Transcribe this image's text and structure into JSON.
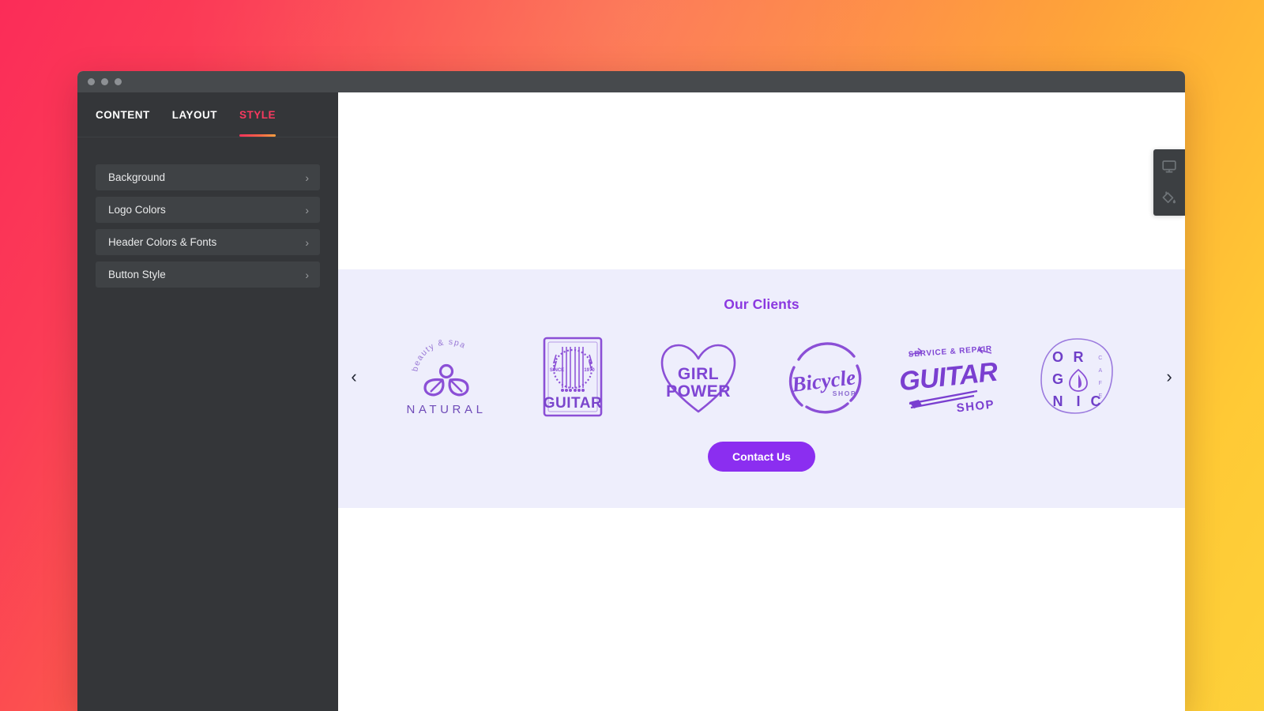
{
  "window": {
    "traffic_lights": [
      "close",
      "minimize",
      "maximize"
    ]
  },
  "sidebar": {
    "tabs": [
      {
        "label": "CONTENT",
        "active": false
      },
      {
        "label": "LAYOUT",
        "active": false
      },
      {
        "label": "STYLE",
        "active": true
      }
    ],
    "panels": [
      {
        "label": "Background",
        "chevron": "›"
      },
      {
        "label": "Logo Colors",
        "chevron": "›"
      },
      {
        "label": "Header Colors & Fonts",
        "chevron": "›"
      },
      {
        "label": "Button Style",
        "chevron": "›"
      }
    ]
  },
  "preview": {
    "clients": {
      "title": "Our Clients",
      "prev_arrow": "‹",
      "next_arrow": "›",
      "logos": [
        {
          "name": "natural-beauty-spa-logo",
          "primary": "NATURAL",
          "secondary": "beauty & spa"
        },
        {
          "name": "guitar-since-1970-logo",
          "primary": "GUITAR",
          "secondary": "SINCE",
          "tertiary": "1970"
        },
        {
          "name": "girl-power-logo",
          "primary": "GIRL",
          "secondary": "POWER"
        },
        {
          "name": "bicycle-shop-logo",
          "primary": "Bicycle",
          "secondary": "SHOP"
        },
        {
          "name": "guitar-shop-service-repair-logo",
          "primary": "GUITAR",
          "secondary": "SHOP",
          "tertiary": "SERVICE & REPAIR"
        },
        {
          "name": "organic-cafe-logo",
          "primary": "ORGANIC",
          "secondary": "CAFE"
        }
      ],
      "cta_label": "Contact Us"
    }
  },
  "toolstrip": {
    "buttons": [
      {
        "name": "device-preview-icon",
        "title": "Desktop preview"
      },
      {
        "name": "paint-bucket-icon",
        "title": "Fill color"
      }
    ]
  },
  "colors": {
    "accent_pink": "#f7395f",
    "accent_orange": "#fca040",
    "brand_purple": "#8b38e0",
    "cta_purple": "#8b2ef0",
    "section_lavender": "#eeeefc",
    "sidebar_bg": "#343639",
    "panel_row_bg": "#3f4245",
    "titlebar_bg": "#474a4d"
  }
}
